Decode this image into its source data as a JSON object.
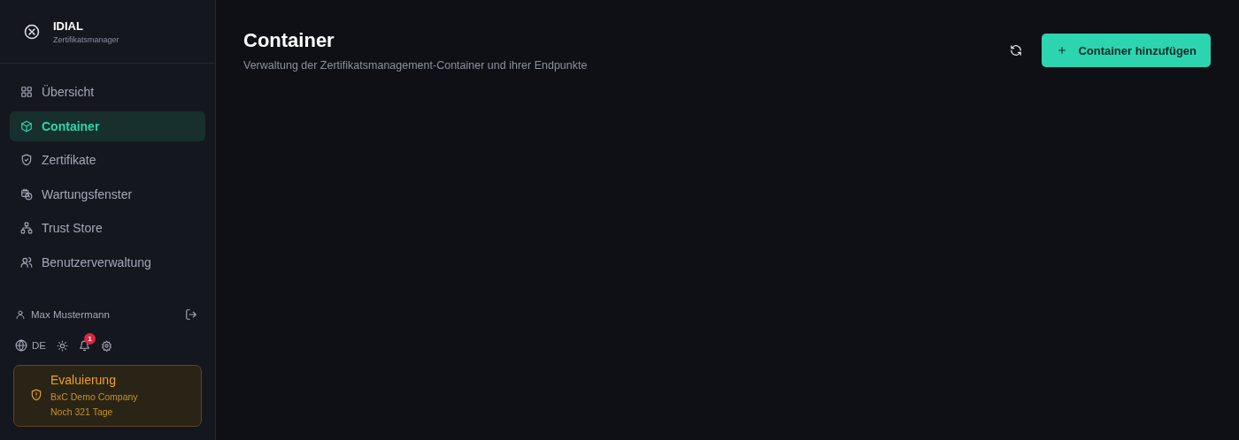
{
  "brand": {
    "title": "IDIAL",
    "subtitle": "Zertifikatsmanager"
  },
  "nav": [
    {
      "label": "Übersicht",
      "selected": false
    },
    {
      "label": "Container",
      "selected": true
    },
    {
      "label": "Zertifikate",
      "selected": false
    },
    {
      "label": "Wartungsfenster",
      "selected": false
    },
    {
      "label": "Trust Store",
      "selected": false
    },
    {
      "label": "Benutzerverwaltung",
      "selected": false
    }
  ],
  "user": {
    "name": "Max Mustermann"
  },
  "toolbar": {
    "language": "DE",
    "notifications": "1"
  },
  "license": {
    "title": "Evaluierung",
    "company": "BxC Demo Company",
    "remaining": "Noch 321 Tage"
  },
  "page": {
    "title": "Container",
    "subtitle": "Verwaltung der Zertifikatsmanagement-Container und ihrer Endpunkte",
    "add_button": "Container hinzufügen"
  }
}
